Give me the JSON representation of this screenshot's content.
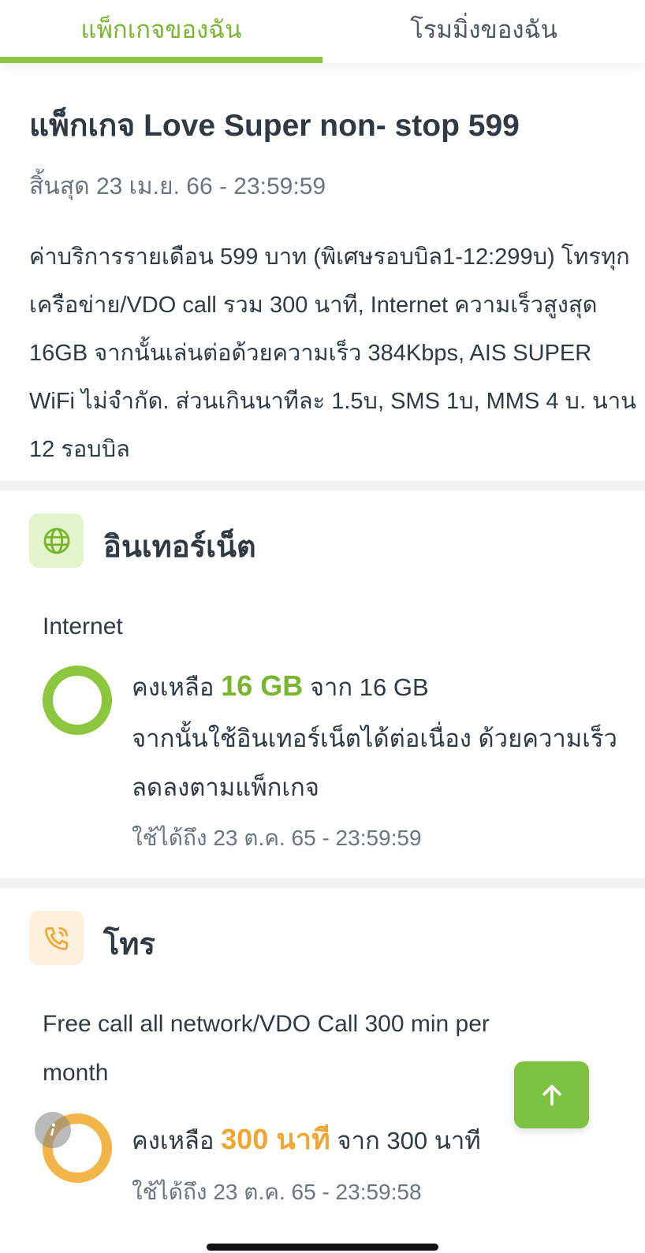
{
  "tabs": {
    "my_package": "แพ็กเกจของฉัน",
    "my_roaming": "โรมมิ่งของฉัน"
  },
  "package": {
    "title": "แพ็กเกจ Love Super non- stop 599",
    "expiry": "สิ้นสุด 23 เม.ย. 66 - 23:59:59",
    "description": "ค่าบริการรายเดือน 599 บาท (พิเศษรอบบิล1-12:299บ) โทรทุกเครือข่าย/VDO call รวม 300 นาที, Internet ความเร็วสูงสุด 16GB จากนั้นเล่นต่อด้วยความเร็ว 384Kbps, AIS SUPER WiFi ไม่จำกัด. ส่วนเกินนาทีละ 1.5บ, SMS 1บ, MMS 4 บ. นาน 12 รอบบิล"
  },
  "internet": {
    "section_title": "อินเทอร์เน็ต",
    "item_title": "Internet",
    "remain_prefix": "คงเหลือ",
    "remain_value": "16 GB",
    "remain_suffix": "จาก 16 GB",
    "remain_fraction": 1.0,
    "note": "จากนั้นใช้อินเทอร์เน็ตได้ต่อเนื่อง ด้วยความเร็วลดลงตามแพ็กเกจ",
    "valid_until": "ใช้ได้ถึง 23 ต.ค. 65 - 23:59:59"
  },
  "call": {
    "section_title": "โทร",
    "item_title": "Free call all network/VDO Call 300 min per month",
    "remain_prefix": "คงเหลือ",
    "remain_value": "300 นาที",
    "remain_suffix": "จาก 300 นาที",
    "remain_fraction": 1.0,
    "valid_until": "ใช้ได้ถึง 23 ต.ค. 65 - 23:59:58"
  },
  "icons": {
    "globe": "globe-icon",
    "phone": "phone-icon",
    "scroll_top": "arrow-up-icon",
    "info": "info-icon"
  },
  "colors": {
    "accent_green": "#8cc63f",
    "accent_orange": "#f3b549",
    "fab_green": "#7dc242"
  }
}
